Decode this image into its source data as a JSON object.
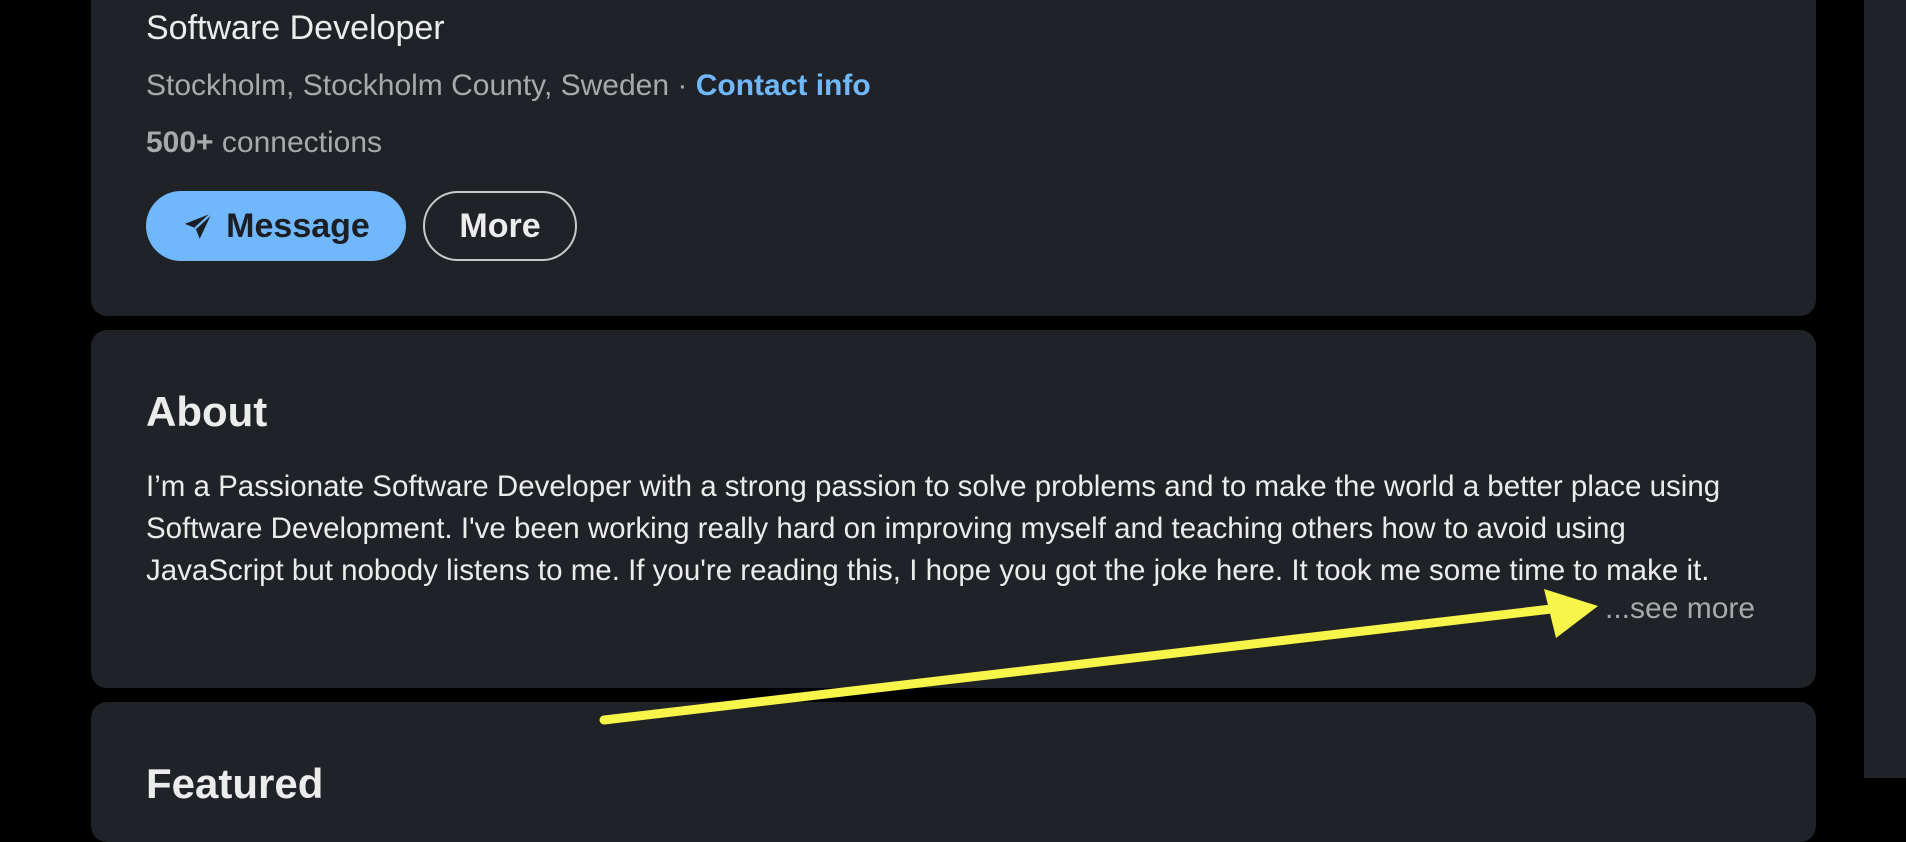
{
  "profile": {
    "headline": "Software Developer",
    "location": "Stockholm, Stockholm County, Sweden",
    "separator": " · ",
    "contact_info_label": "Contact info",
    "connections_count": "500+",
    "connections_label": " connections",
    "message_button_label": "Message",
    "more_button_label": "More"
  },
  "about": {
    "title": "About",
    "text": "I’m a Passionate Software Developer with a strong passion to solve problems and to make the world a better place using Software Development. I've been working really hard on improving myself and teaching others how to avoid using JavaScript but nobody listens to me. If you're reading this, I hope you got the joke here. It took me some time to make it.",
    "see_more_label": "...see more"
  },
  "featured": {
    "title": "Featured"
  },
  "icons": {
    "message_button_icon": "send-icon",
    "annotation": "arrow-annotation"
  },
  "colors": {
    "background": "#000000",
    "card": "#1f2226",
    "accent": "#71b7fb",
    "muted_text": "#a7a9ab",
    "annotation": "#f8f54a"
  }
}
